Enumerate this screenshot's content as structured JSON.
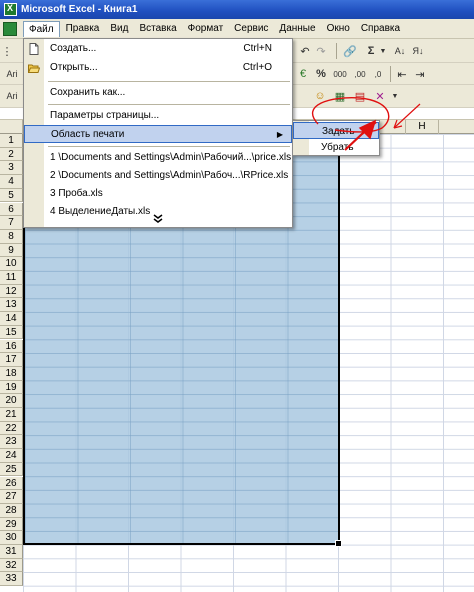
{
  "window": {
    "title": "Microsoft Excel - Книга1"
  },
  "menubar": {
    "items": [
      {
        "label": "Файл",
        "accel": "Ф"
      },
      {
        "label": "Правка",
        "accel": "П"
      },
      {
        "label": "Вид",
        "accel": "В"
      },
      {
        "label": "Вставка",
        "accel": "т"
      },
      {
        "label": "Формат",
        "accel": "о"
      },
      {
        "label": "Сервис",
        "accel": "е"
      },
      {
        "label": "Данные",
        "accel": "Д"
      },
      {
        "label": "Окно",
        "accel": "О"
      },
      {
        "label": "Справка",
        "accel": "С"
      }
    ]
  },
  "toolbar": {
    "font_stub_1": "Ari",
    "font_stub_2": "Ari",
    "sum_symbol": "Σ",
    "percent": "%",
    "thousands": "000"
  },
  "file_menu": {
    "items": [
      {
        "label": "Создать...",
        "shortcut": "Ctrl+N",
        "icon": "new-document-icon"
      },
      {
        "label": "Открыть...",
        "shortcut": "Ctrl+O",
        "icon": "open-folder-icon"
      },
      {
        "label": "Сохранить как..."
      },
      {
        "label": "Параметры страницы..."
      },
      {
        "label": "Область печати",
        "has_submenu": true
      },
      {
        "label": "1 \\Documents and Settings\\Admin\\Рабочий...\\price.xls"
      },
      {
        "label": "2 \\Documents and Settings\\Admin\\Рабоч...\\RPrice.xls"
      },
      {
        "label": "3 Проба.xls"
      },
      {
        "label": "4 ВыделениеДаты.xls"
      }
    ],
    "expand_icon": "double-chevron-down-icon"
  },
  "submenu": {
    "items": [
      {
        "label": "Задать"
      },
      {
        "label": "Убрать"
      }
    ]
  },
  "grid": {
    "column_visible": "H",
    "row_numbers": [
      "1",
      "2",
      "3",
      "4",
      "5",
      "6",
      "7",
      "8",
      "9",
      "10",
      "11",
      "12",
      "13",
      "14",
      "15",
      "16",
      "17",
      "18",
      "19",
      "20",
      "21",
      "22",
      "23",
      "24",
      "25",
      "26",
      "27",
      "28",
      "29",
      "30",
      "31",
      "32",
      "33"
    ]
  },
  "colors": {
    "titlebar": "#1f4fbf",
    "selection": "#a9c8e1",
    "menu_highlight": "#c1d2ee",
    "annotation_red": "#e01010"
  }
}
